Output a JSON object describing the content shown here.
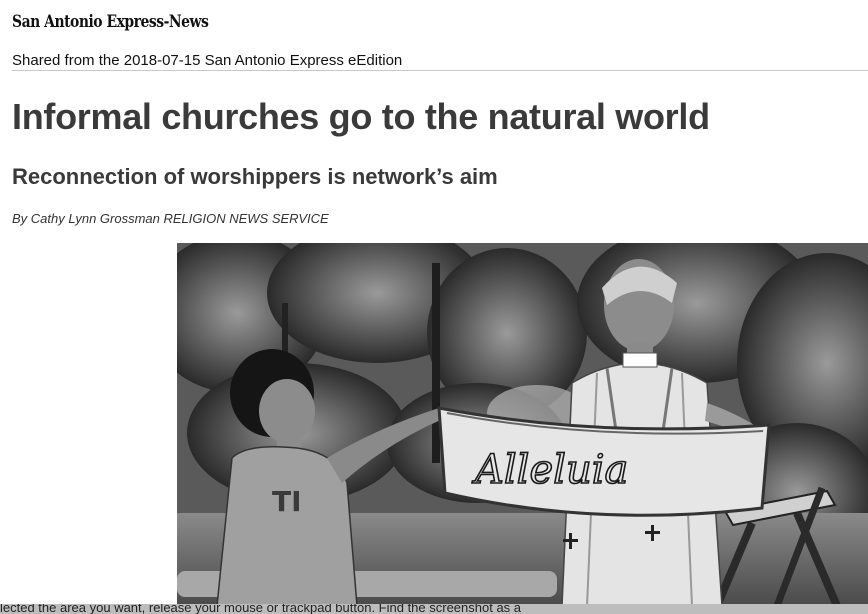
{
  "masthead": {
    "logo_text": "San Antonio Express-News"
  },
  "share": {
    "text": "Shared from the 2018-07-15 San Antonio Express eEdition"
  },
  "article": {
    "headline": "Informal churches go to the natural world",
    "subheadline": "Reconnection of worshippers is network’s aim",
    "byline": "By Cathy Lynn Grossman RELIGION NEWS SERVICE"
  },
  "banner": {
    "lettering": "Alleluia"
  },
  "overlay": {
    "instruction_text": "lected the area you want, release your mouse or trackpad button. Find the screenshot as a"
  },
  "colors": {
    "headline": "#3a3a3a",
    "rule": "#c8c8c8"
  }
}
